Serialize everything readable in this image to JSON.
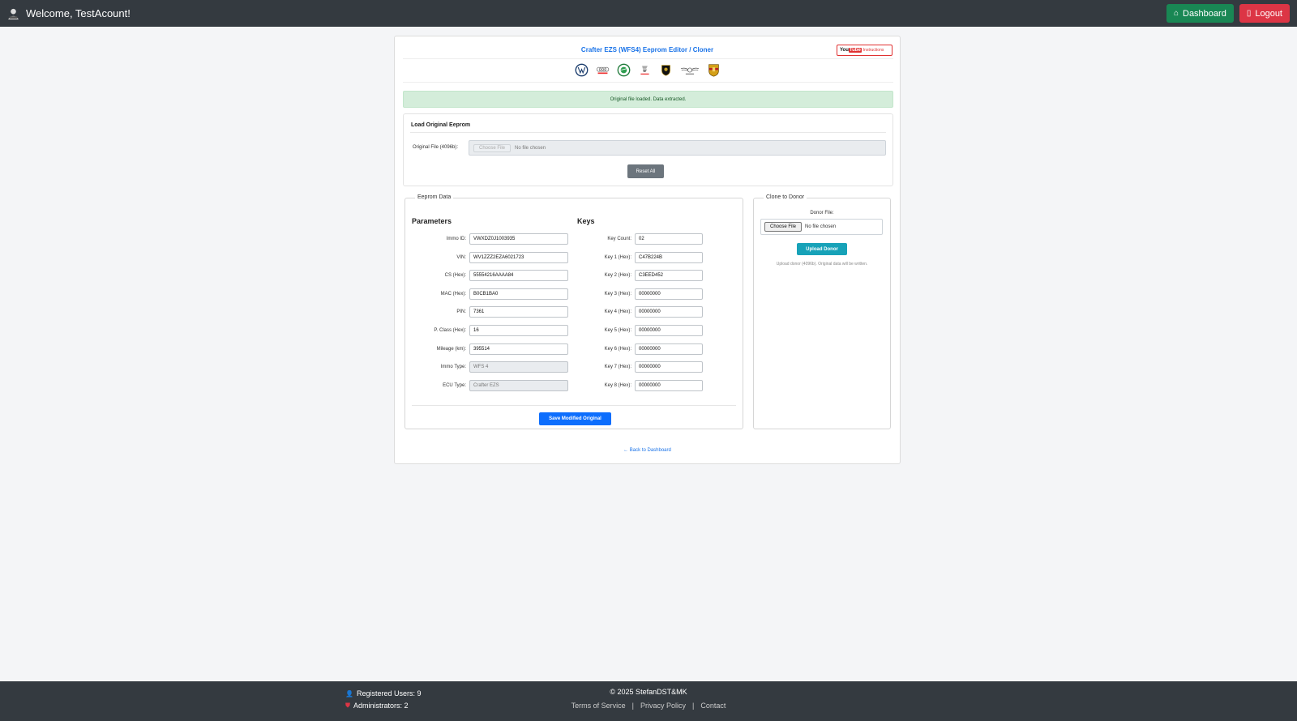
{
  "header": {
    "welcome": "Welcome, TestAcount!",
    "dashboard_label": "Dashboard",
    "logout_label": "Logout"
  },
  "main": {
    "title": "Crafter EZS (WFS4) Eeprom Editor / Cloner",
    "youtube": {
      "logo_you": "You",
      "logo_tube": "Tube",
      "label": "Instructions"
    },
    "brands": [
      "vw-logo",
      "audi-logo",
      "skoda-logo",
      "seat-logo",
      "lamborghini-logo",
      "bentley-logo",
      "porsche-logo"
    ],
    "alert": "Original file loaded. Data extracted.",
    "load": {
      "title": "Load Original Eeprom",
      "label": "Original File (4096b):",
      "choose": "Choose File",
      "no_file": "No file chosen",
      "reset": "Reset All"
    },
    "eeprom": {
      "legend": "Eeprom Data",
      "params_title": "Parameters",
      "keys_title": "Keys",
      "params": [
        {
          "label": "Immo ID:",
          "value": "VWXDZ0J1003935",
          "disabled": false
        },
        {
          "label": "VIN:",
          "value": "WV1ZZZ2EZA6021723",
          "disabled": false
        },
        {
          "label": "CS (Hex):",
          "value": "55554216AAAA84",
          "disabled": false
        },
        {
          "label": "MAC (Hex):",
          "value": "B0CB1BA0",
          "disabled": false
        },
        {
          "label": "PIN:",
          "value": "7361",
          "disabled": false
        },
        {
          "label": "P. Class (Hex):",
          "value": "16",
          "disabled": false
        },
        {
          "label": "Mileage (km):",
          "value": "395514",
          "disabled": false
        },
        {
          "label": "Immo Type:",
          "value": "WFS 4",
          "disabled": true
        },
        {
          "label": "ECU Type:",
          "value": "Crafter EZS",
          "disabled": true
        }
      ],
      "keys": [
        {
          "label": "Key Count:",
          "value": "02"
        },
        {
          "label": "Key 1 (Hex):",
          "value": "C47B224B"
        },
        {
          "label": "Key 2 (Hex):",
          "value": "C3EED452"
        },
        {
          "label": "Key 3 (Hex):",
          "value": "00000000"
        },
        {
          "label": "Key 4 (Hex):",
          "value": "00000000"
        },
        {
          "label": "Key 5 (Hex):",
          "value": "00000000"
        },
        {
          "label": "Key 6 (Hex):",
          "value": "00000000"
        },
        {
          "label": "Key 7 (Hex):",
          "value": "00000000"
        },
        {
          "label": "Key 8 (Hex):",
          "value": "00000000"
        }
      ],
      "save": "Save Modified Original"
    },
    "clone": {
      "legend": "Clone to Donor",
      "donor_label": "Donor File:",
      "choose": "Choose File",
      "no_file": "No file chosen",
      "upload": "Upload Donor",
      "hint": "Upload donor (4096b). Original data will be written."
    },
    "back": "← Back to Dashboard"
  },
  "footer": {
    "registered": "Registered Users: 9",
    "admins": "Administrators: 2",
    "copyright": "© 2025 StefanDST&MK",
    "links": [
      "Terms of Service",
      "Privacy Policy",
      "Contact"
    ]
  },
  "colors": {
    "topbar": "#343a40",
    "dashboard": "#198754",
    "logout": "#dc3545",
    "primary": "#0d6efd",
    "info": "#17a2b8",
    "secondary": "#6c757d",
    "success_bg": "#d4edda"
  }
}
